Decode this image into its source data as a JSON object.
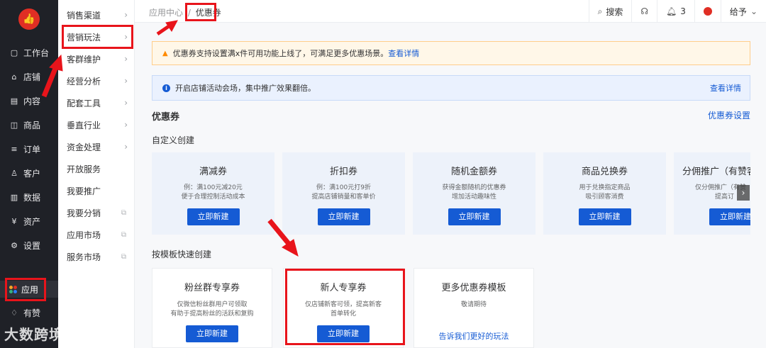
{
  "nav": {
    "logo_icon": "thumb-up-icon",
    "items": [
      {
        "label": "工作台",
        "icon": "monitor-icon"
      },
      {
        "label": "店铺",
        "icon": "store-icon"
      },
      {
        "label": "内容",
        "icon": "document-icon"
      },
      {
        "label": "商品",
        "icon": "bag-icon"
      },
      {
        "label": "订单",
        "icon": "list-icon"
      },
      {
        "label": "客户",
        "icon": "user-icon"
      },
      {
        "label": "数据",
        "icon": "chart-icon"
      },
      {
        "label": "资产",
        "icon": "yen-icon"
      },
      {
        "label": "设置",
        "icon": "gear-icon"
      },
      {
        "label": "应用",
        "icon": "apps-icon"
      },
      {
        "label": "有赞",
        "icon": "thumb-icon"
      }
    ]
  },
  "subnav": {
    "items": [
      {
        "label": "销售渠道"
      },
      {
        "label": "营销玩法"
      },
      {
        "label": "客群维护"
      },
      {
        "label": "经营分析"
      },
      {
        "label": "配套工具"
      },
      {
        "label": "垂直行业"
      },
      {
        "label": "资金处理"
      },
      {
        "label": "开放服务"
      },
      {
        "label": "我要推广"
      },
      {
        "label": "我要分销"
      },
      {
        "label": "应用市场"
      },
      {
        "label": "服务市场"
      }
    ]
  },
  "topbar": {
    "breadcrumb_parent": "应用中心",
    "breadcrumb_sep": "/",
    "breadcrumb_current": "优惠券",
    "search_label": "搜索",
    "notification_count": "3",
    "user_name": "给予"
  },
  "notices": {
    "warning_text": "优惠券支持设置满x件可用功能上线了，可满足更多优惠场景。",
    "warning_link": "查看详情",
    "info_text": "开启店铺活动会场，集中推广效果翻倍。",
    "info_link": "查看详情"
  },
  "page": {
    "title": "优惠券",
    "settings_link": "优惠券设置",
    "custom_label": "自定义创建",
    "template_label": "按模板快速创建"
  },
  "custom_cards": [
    {
      "title": "满减券",
      "desc1": "例：满100元减20元",
      "desc2": "便于合理控制活动成本",
      "button": "立即新建"
    },
    {
      "title": "折扣券",
      "desc1": "例：满100元打9折",
      "desc2": "提高店铺销量和客单价",
      "button": "立即新建"
    },
    {
      "title": "随机金额券",
      "desc1": "获得金额随机的优惠券",
      "desc2": "增加活动趣味性",
      "button": "立即新建"
    },
    {
      "title": "商品兑换券",
      "desc1": "用于兑换指定商品",
      "desc2": "吸引顾客消费",
      "button": "立即新建"
    },
    {
      "title": "分佣推广（有赞客",
      "desc1": "仅分佣推广（有赞",
      "desc2": "提高订",
      "button": "立即新建"
    }
  ],
  "template_cards": [
    {
      "title": "粉丝群专享券",
      "desc1": "仅微信粉丝群用户可领取",
      "desc2": "有助于提高粉丝的活跃和复购",
      "button": "立即新建"
    },
    {
      "title": "新人专享券",
      "desc1": "仅店铺新客可领，提高新客",
      "desc2": "首单转化",
      "button": "立即新建"
    },
    {
      "title": "更多优惠券模板",
      "desc1": "敬请期待",
      "desc2": "",
      "link": "告诉我们更好的玩法"
    }
  ],
  "watermark": "大数跨境",
  "colors": {
    "primary": "#155bd4",
    "annotation": "#e8141b",
    "brand": "#e02e24"
  }
}
